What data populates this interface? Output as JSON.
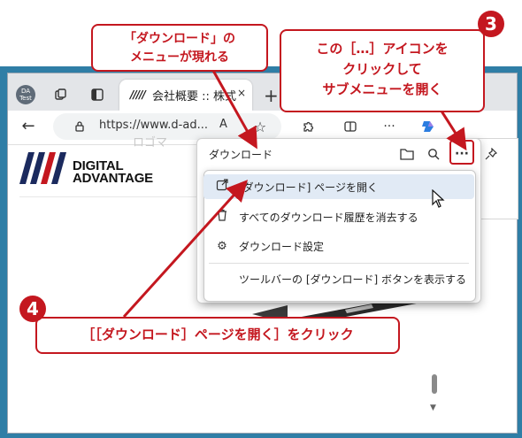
{
  "browser": {
    "profile_label": "DA\nTest",
    "tab": {
      "title": "会社概要 :: 株式",
      "close": "×"
    },
    "new_tab": "+",
    "address": {
      "url": "https://www.d-ad..."
    },
    "read_aloud": "A",
    "more": "···"
  },
  "page": {
    "logo_line1": "DIGITAL",
    "logo_line2": "ADVANTAGE",
    "faded_text": "ロゴマ"
  },
  "downloads_panel": {
    "title": "ダウンロード",
    "menu": [
      {
        "label": "[ダウンロード] ページを開く",
        "icon": "open-external-icon",
        "highlighted": true
      },
      {
        "label": "すべてのダウンロード履歴を消去する",
        "icon": "trash-icon",
        "highlighted": false
      },
      {
        "label": "ダウンロード設定",
        "icon": "gear-icon",
        "highlighted": false
      },
      {
        "label": "ツールバーの [ダウンロード] ボタンを表示する",
        "icon": "",
        "highlighted": false
      }
    ]
  },
  "annotations": {
    "callout_menu": {
      "line1": "「ダウンロード」の",
      "line2": "メニューが現れる"
    },
    "callout_3": {
      "line1": "この［…］アイコンを",
      "line2": "クリックして",
      "line3": "サブメニューを開く"
    },
    "callout_4": {
      "text": "［［ダウンロード］ページを開く］をクリック"
    },
    "badge_3": "3",
    "badge_4": "4"
  },
  "colors": {
    "accent_red": "#c4171f",
    "desktop_blue": "#2f7ea6",
    "menu_highlight": "#e1eaf5"
  }
}
